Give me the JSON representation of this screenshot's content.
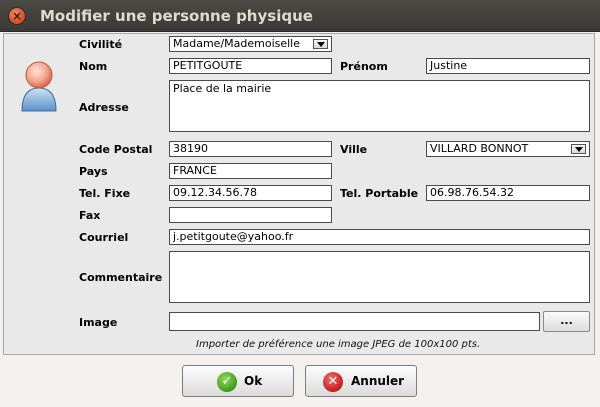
{
  "window": {
    "title": "Modifier une personne physique"
  },
  "form": {
    "civilite": {
      "label": "Civilité",
      "value": "Madame/Mademoiselle"
    },
    "nom": {
      "label": "Nom",
      "value": "PETITGOUTE"
    },
    "prenom": {
      "label": "Prénom",
      "value": "Justine"
    },
    "adresse": {
      "label": "Adresse",
      "value": "Place de la mairie"
    },
    "code_postal": {
      "label": "Code Postal",
      "value": "38190"
    },
    "ville": {
      "label": "Ville",
      "value": "VILLARD BONNOT"
    },
    "pays": {
      "label": "Pays",
      "value": "FRANCE"
    },
    "tel_fixe": {
      "label": "Tel. Fixe",
      "value": "09.12.34.56.78"
    },
    "tel_portable": {
      "label": "Tel. Portable",
      "value": "06.98.76.54.32"
    },
    "fax": {
      "label": "Fax",
      "value": ""
    },
    "courriel": {
      "label": "Courriel",
      "value": "j.petitgoute@yahoo.fr"
    },
    "commentaire": {
      "label": "Commentaire",
      "value": ""
    },
    "image": {
      "label": "Image",
      "value": "",
      "browse_label": "..."
    },
    "hint": "Importer de préférence une image JPEG de 100x100 pts."
  },
  "buttons": {
    "ok_label": "Ok",
    "cancel_label": "Annuler"
  },
  "icons": {
    "window_close": "close-icon",
    "avatar": "person-icon",
    "ok": "check-icon",
    "cancel": "x-icon"
  }
}
